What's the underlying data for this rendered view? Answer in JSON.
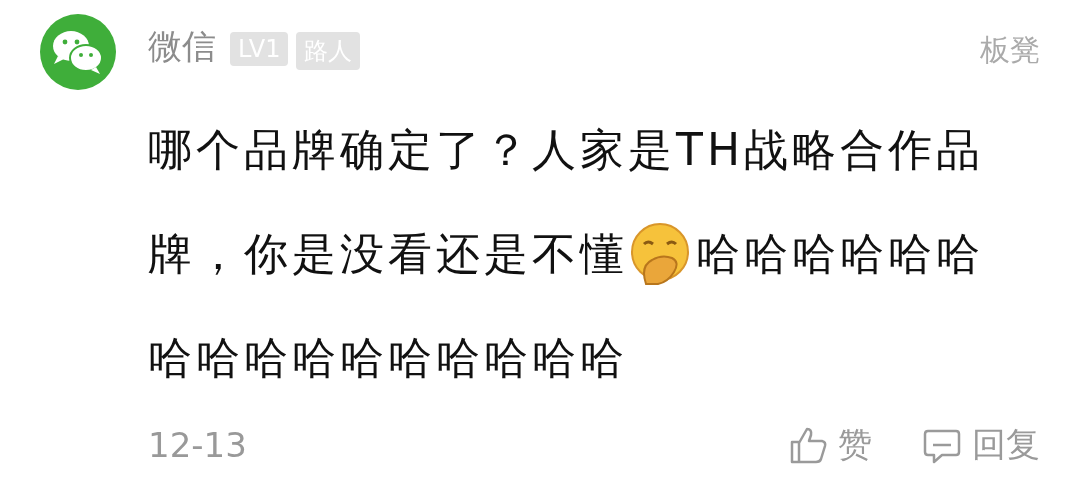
{
  "comment": {
    "author": "微信",
    "badges": [
      "LV1",
      "路人"
    ],
    "floor": "板凳",
    "content": [
      [
        {
          "kind": "text",
          "text": "哪个品牌确定了？人家是TH战略合作品"
        }
      ],
      [
        {
          "kind": "text",
          "text": "牌，你是没看还是不懂"
        },
        {
          "kind": "emoji"
        },
        {
          "kind": "text",
          "text": "哈哈哈哈哈哈"
        }
      ],
      [
        {
          "kind": "text",
          "text": "哈哈哈哈哈哈哈哈哈哈"
        }
      ]
    ],
    "date": "12-13",
    "actions": [
      {
        "kind": "like",
        "label": "赞"
      },
      {
        "kind": "reply",
        "label": "回复"
      }
    ]
  }
}
